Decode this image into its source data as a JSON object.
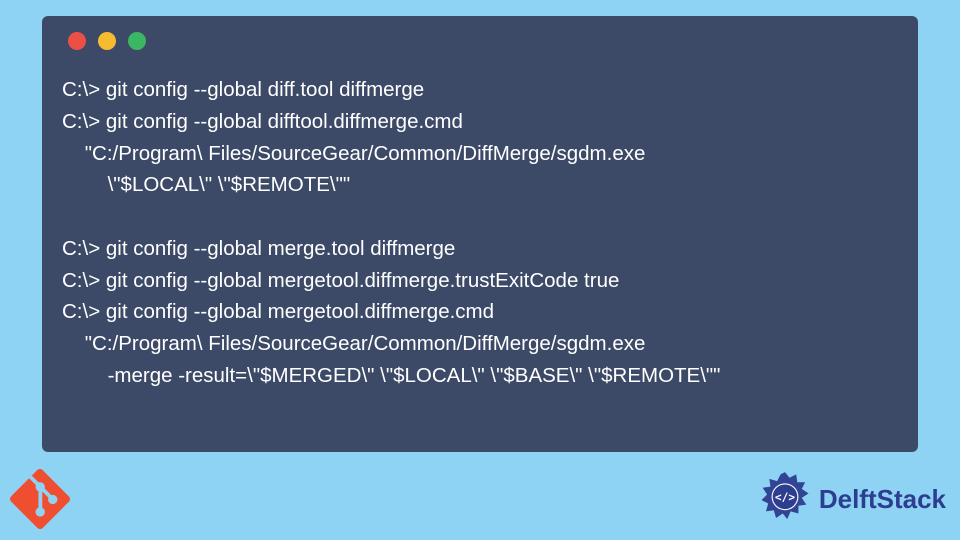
{
  "terminal": {
    "lines": [
      "C:\\> git config --global diff.tool diffmerge",
      "C:\\> git config --global difftool.diffmerge.cmd",
      "    \"C:/Program\\ Files/SourceGear/Common/DiffMerge/sgdm.exe",
      "        \\\"$LOCAL\\\" \\\"$REMOTE\\\"\"",
      "",
      "C:\\> git config --global merge.tool diffmerge",
      "C:\\> git config --global mergetool.diffmerge.trustExitCode true",
      "C:\\> git config --global mergetool.diffmerge.cmd",
      "    \"C:/Program\\ Files/SourceGear/Common/DiffMerge/sgdm.exe",
      "        -merge -result=\\\"$MERGED\\\" \\\"$LOCAL\\\" \\\"$BASE\\\" \\\"$REMOTE\\\"\""
    ]
  },
  "branding": {
    "name": "DelftStack"
  },
  "colors": {
    "bg": "#8ed3f4",
    "terminal": "#3c4a68",
    "git": "#f04e31",
    "delft": "#2d3d8f"
  }
}
